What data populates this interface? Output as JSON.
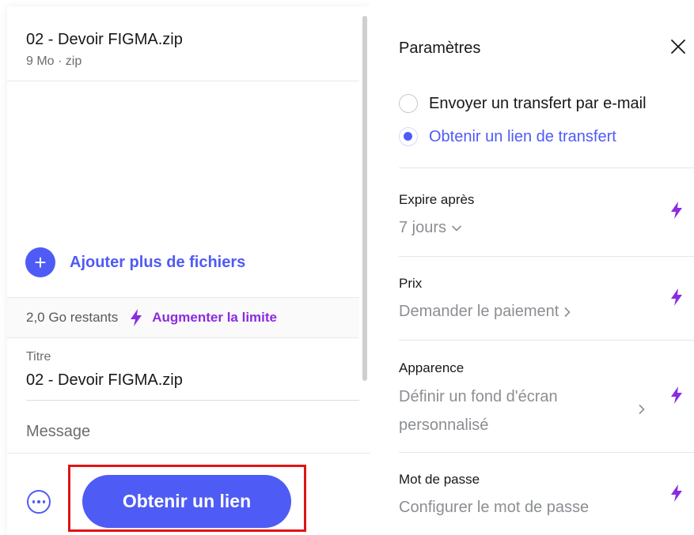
{
  "upload": {
    "file": {
      "name": "02 - Devoir FIGMA.zip",
      "meta": "9 Mo · zip"
    },
    "add_files_label": "Ajouter plus de fichiers",
    "quota": {
      "remaining": "2,0 Go restants",
      "upgrade_label": "Augmenter la limite"
    },
    "title_field": {
      "label": "Titre",
      "value": "02 - Devoir FIGMA.zip"
    },
    "message_field": {
      "placeholder": "Message"
    },
    "primary_button_label": "Obtenir un lien"
  },
  "settings": {
    "title": "Paramètres",
    "options": [
      {
        "label": "Envoyer un transfert par e-mail",
        "selected": false
      },
      {
        "label": "Obtenir un lien de transfert",
        "selected": true
      }
    ],
    "rows": [
      {
        "label": "Expire après",
        "value": "7 jours"
      },
      {
        "label": "Prix",
        "value": "Demander le paiement"
      },
      {
        "label": "Apparence",
        "value_line1": "Définir un fond d'écran",
        "value_line2": "personnalisé"
      },
      {
        "label": "Mot de passe",
        "value": "Configurer le mot de passe"
      }
    ]
  },
  "colors": {
    "accent": "#4f5bf5",
    "premium": "#8a2be2",
    "highlight": "#e01515"
  },
  "icons": {
    "add": "plus-icon",
    "premium": "lightning-bolt-icon",
    "more": "more-dots-icon",
    "close": "close-icon",
    "dropdown": "chevron-down-icon",
    "next": "chevron-right-icon"
  }
}
